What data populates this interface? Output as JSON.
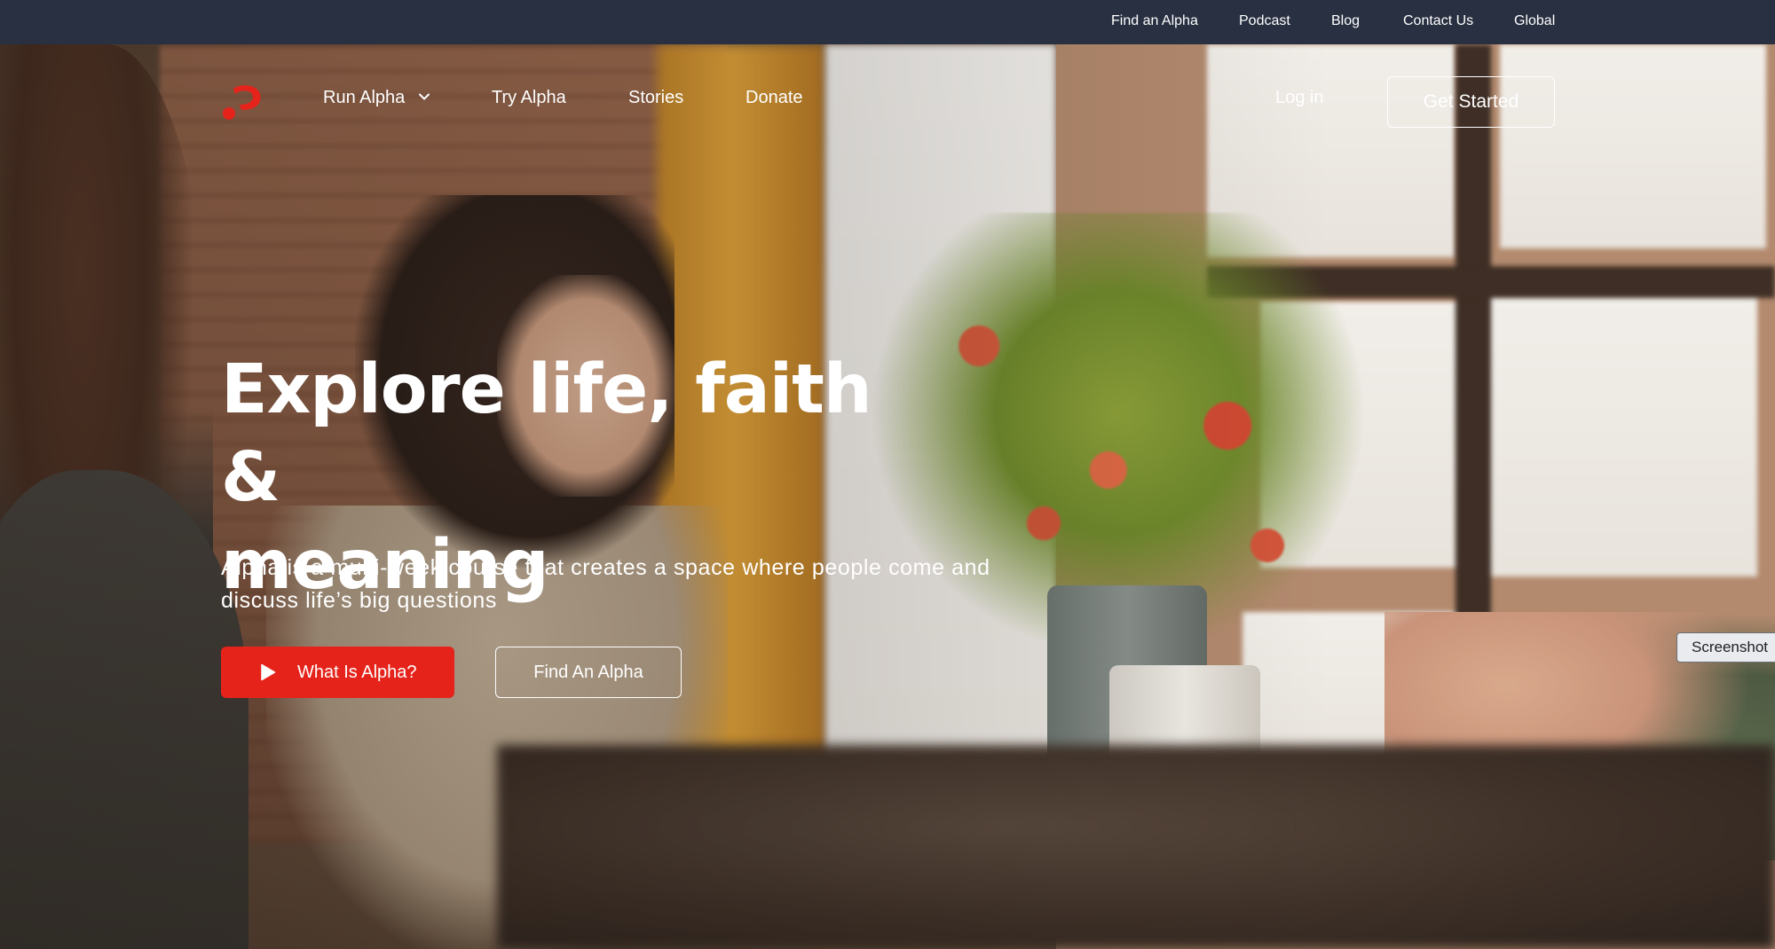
{
  "utility_nav": {
    "items": [
      {
        "label": "Find an Alpha"
      },
      {
        "label": "Podcast"
      },
      {
        "label": "Blog"
      },
      {
        "label": "Contact Us"
      },
      {
        "label": "Global"
      }
    ]
  },
  "main_nav": {
    "logo_icon": "alpha-question-mark-logo-icon",
    "items": [
      {
        "label": "Run Alpha",
        "has_dropdown": true
      },
      {
        "label": "Try Alpha"
      },
      {
        "label": "Stories"
      },
      {
        "label": "Donate"
      }
    ],
    "login_label": "Log in",
    "cta_label": "Get Started"
  },
  "hero": {
    "title_line1": "Explore life, faith &",
    "title_line2": "meaning",
    "subtitle_line1": "Alpha is a multi-week course that creates a space where people come and",
    "subtitle_line2": "discuss life’s big questions",
    "primary_button": {
      "label": "What Is Alpha?",
      "icon": "play-icon"
    },
    "secondary_button": {
      "label": "Find An Alpha"
    }
  },
  "overlay": {
    "screenshot_tab_label": "Screenshot"
  },
  "colors": {
    "brand_red": "#e5231b",
    "utility_bar": "#283041",
    "text": "#ffffff"
  }
}
